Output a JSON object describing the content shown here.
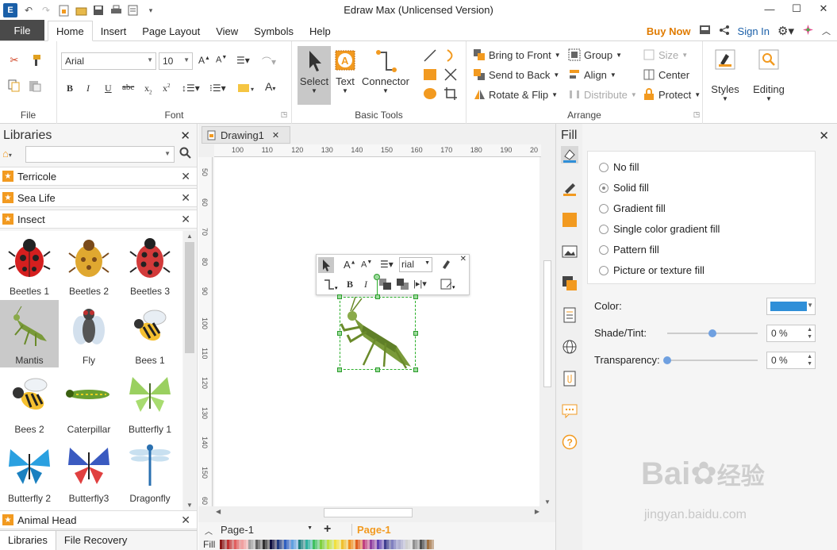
{
  "app": {
    "title": "Edraw Max (Unlicensed Version)",
    "logo": "E"
  },
  "menu": {
    "file": "File",
    "tabs": [
      "Home",
      "Insert",
      "Page Layout",
      "View",
      "Symbols",
      "Help"
    ],
    "buy_now": "Buy Now",
    "sign_in": "Sign In"
  },
  "ribbon": {
    "file_group": "File",
    "font_group": "Font",
    "font_name": "Arial",
    "font_size": "10",
    "basic_tools_group": "Basic Tools",
    "select": "Select",
    "text": "Text",
    "connector": "Connector",
    "arrange_group": "Arrange",
    "bring_to_front": "Bring to Front",
    "send_to_back": "Send to Back",
    "rotate_flip": "Rotate & Flip",
    "group": "Group",
    "align": "Align",
    "distribute": "Distribute",
    "size": "Size",
    "center": "Center",
    "protect": "Protect",
    "styles": "Styles",
    "editing": "Editing"
  },
  "libraries": {
    "title": "Libraries",
    "categories": [
      "Terricole",
      "Sea Life",
      "Insect"
    ],
    "bottom_category": "Animal Head",
    "items": [
      "Beetles 1",
      "Beetles 2",
      "Beetles 3",
      "Mantis",
      "Fly",
      "Bees 1",
      "Bees 2",
      "Caterpillar",
      "Butterfly 1",
      "Butterfly 2",
      "Butterfly3",
      "Dragonfly"
    ],
    "tab_libraries": "Libraries",
    "tab_file_recovery": "File Recovery"
  },
  "canvas": {
    "doc_tab": "Drawing1",
    "ruler_h": [
      "100",
      "110",
      "120",
      "130",
      "140",
      "150",
      "160",
      "170",
      "180",
      "190",
      "20"
    ],
    "ruler_v": [
      "50",
      "60",
      "70",
      "80",
      "90",
      "100",
      "110",
      "120",
      "130",
      "140",
      "150",
      "60"
    ],
    "minibar_font": "rial",
    "page_select": "Page-1",
    "page_tab": "Page-1",
    "fill_label": "Fill"
  },
  "fill_panel": {
    "title": "Fill",
    "options": [
      "No fill",
      "Solid fill",
      "Gradient fill",
      "Single color gradient fill",
      "Pattern fill",
      "Picture or texture fill"
    ],
    "selected_option": "Solid fill",
    "color_label": "Color:",
    "color_value": "#2f8fd8",
    "shade_label": "Shade/Tint:",
    "shade_value": "0 %",
    "shade_position": 0.5,
    "transparency_label": "Transparency:",
    "transparency_value": "0 %",
    "transparency_position": 0
  },
  "watermark": {
    "line1": "Bai",
    "line1_cn": "经验",
    "line2": "jingyan.baidu.com"
  }
}
